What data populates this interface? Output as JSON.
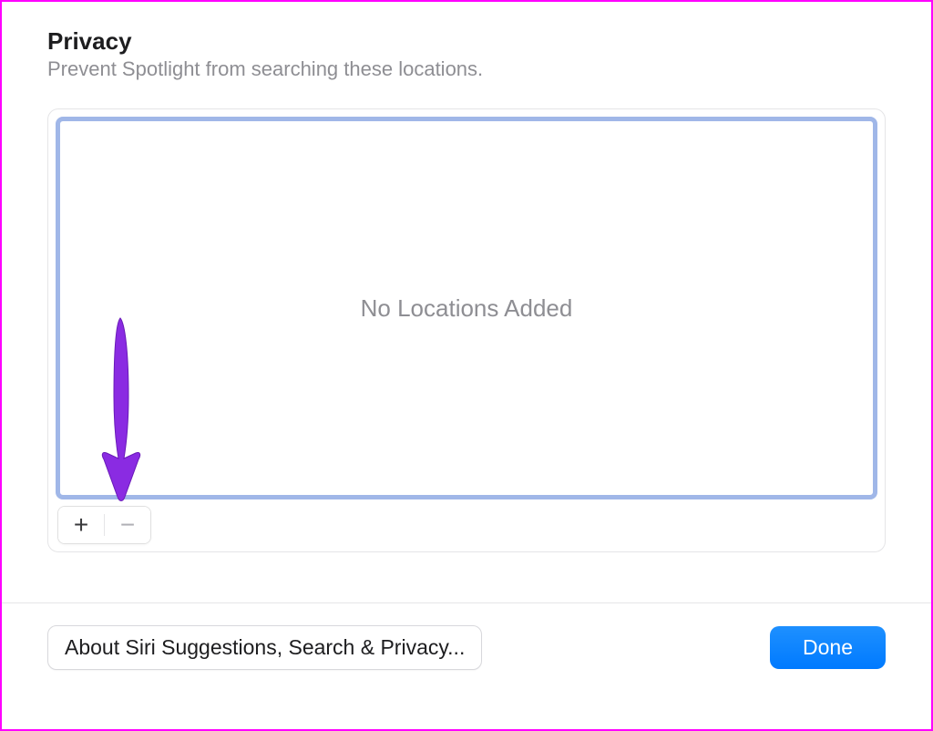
{
  "header": {
    "title": "Privacy",
    "subtitle": "Prevent Spotlight from searching these locations."
  },
  "locations": {
    "empty_text": "No Locations Added"
  },
  "controls": {
    "add_glyph": "+",
    "remove_glyph": "−"
  },
  "footer": {
    "about_label": "About Siri Suggestions, Search & Privacy...",
    "done_label": "Done"
  }
}
